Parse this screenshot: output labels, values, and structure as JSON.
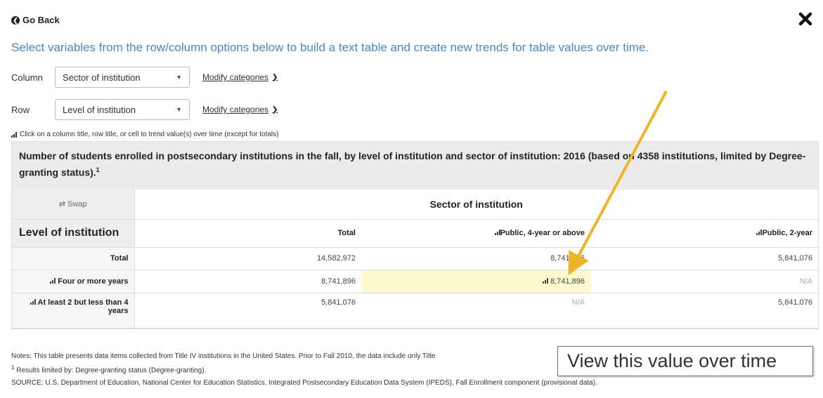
{
  "nav": {
    "go_back": "Go Back"
  },
  "heading": "Select variables from the row/column options below to build a text table and create new trends for table values over time.",
  "column_control": {
    "label": "Column",
    "selected": "Sector of institution",
    "modify": "Modify categories"
  },
  "row_control": {
    "label": "Row",
    "selected": "Level of institution",
    "modify": "Modify categories"
  },
  "hint": "Click on a column title, row title, or cell to trend value(s) over time (except for totals)",
  "table": {
    "caption": "Number of students enrolled in postsecondary institutions in the fall, by level of institution and sector of institution: 2016  (based on 4358 institutions, limited by Degree-granting status).",
    "caption_sup": "1",
    "swap_label": "Swap",
    "column_group": "Sector of institution",
    "row_group": "Level of institution",
    "columns": [
      "Total",
      "Public, 4-year or above",
      "Public, 2-year"
    ],
    "rows": [
      {
        "label": "Total",
        "values": [
          "14,582,972",
          "8,741,896",
          "5,841,076"
        ]
      },
      {
        "label": "Four or more years",
        "values": [
          "8,741,896",
          "8,741,896",
          "N/A"
        ]
      },
      {
        "label": "At least 2 but less than 4 years",
        "values": [
          "5,841,076",
          "N/A",
          "5,841,076"
        ]
      }
    ]
  },
  "tooltip": "View this value over time",
  "notes": {
    "note1": "Notes: This table presents data items collected from Title IV institutions in the United States. Prior to Fall 2010, the data include only Title",
    "footnote_sup": "1",
    "footnote": "Results limited by: Degree-granting status (Degree-granting).",
    "source": "SOURCE: U.S. Department of Education, National Center for Education Statistics, Integrated Postsecondary Education Data System (IPEDS), Fall Enrollment component (provisional data)."
  },
  "colors": {
    "heading": "#4a86c8",
    "highlight": "#fdf9cf",
    "annotation_arrow": "#f0b429"
  },
  "icons": {
    "back": "arrow-circle-left-icon",
    "close": "close-icon",
    "trend": "bar-chart-icon",
    "swap": "shuffle-icon",
    "dropdown": "caret-down-icon",
    "expand": "chevron-down-icon"
  }
}
